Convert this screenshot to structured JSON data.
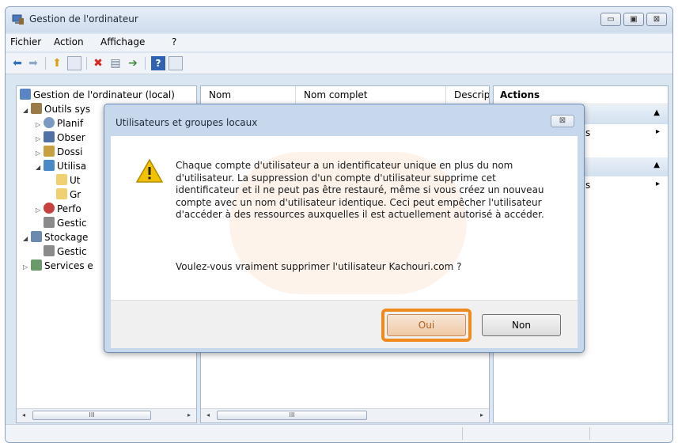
{
  "window": {
    "title": "Gestion de l'ordinateur",
    "controls": {
      "minimize": "▭",
      "maximize": "▣",
      "close": "⊠"
    }
  },
  "menu": [
    "Fichier",
    "Action",
    "Affichage",
    "?"
  ],
  "toolbar": {
    "icons": [
      "back-arrow-icon",
      "forward-arrow-icon",
      "up-folder-icon",
      "show-hide-tree-icon",
      "delete-icon",
      "properties-icon",
      "export-icon",
      "help-icon",
      "action-pane-icon"
    ]
  },
  "tree": {
    "root": "Gestion de l'ordinateur (local)",
    "items": [
      {
        "label": "Outils sys",
        "expand": "◢"
      },
      {
        "label": "Planif",
        "expand": "▷"
      },
      {
        "label": "Obser",
        "expand": "▷"
      },
      {
        "label": "Dossi",
        "expand": "▷"
      },
      {
        "label": "Utilisa",
        "expand": "◢"
      },
      {
        "label": "Ut",
        "expand": ""
      },
      {
        "label": "Gr",
        "expand": ""
      },
      {
        "label": "Perfo",
        "expand": "▷"
      },
      {
        "label": "Gestic",
        "expand": ""
      },
      {
        "label": "Stockage",
        "expand": "◢"
      },
      {
        "label": "Gestic",
        "expand": ""
      },
      {
        "label": "Services e",
        "expand": "▷"
      }
    ]
  },
  "list": {
    "columns": [
      "Nom",
      "Nom complet",
      "Descrip"
    ]
  },
  "scroll": {
    "thumb": "III",
    "left": "◂",
    "right": "▸"
  },
  "actions": {
    "title": "Actions",
    "rows": [
      {
        "text": "s",
        "arrow": "▸"
      },
      {
        "text": "s",
        "arrow": "▸"
      }
    ],
    "collapse": "▲"
  },
  "dialog": {
    "title": "Utilisateurs et groupes locaux",
    "close": "⊠",
    "message": "Chaque compte d'utilisateur a un identificateur unique en plus du nom d'utilisateur. La suppression d'un compte d'utilisateur supprime cet identificateur et il ne peut pas être restauré, même si vous créez un nouveau compte avec un nom d'utilisateur identique. Ceci peut empêcher l'utilisateur d'accéder à des ressources auxquelles il est actuellement autorisé à accéder.",
    "question": "Voulez-vous vraiment supprimer l'utilisateur Kachouri.com ?",
    "buttons": {
      "yes": "Oui",
      "no": "Non"
    }
  },
  "colors": {
    "highlight": "#f08a1c",
    "warning": "#f2c200"
  }
}
